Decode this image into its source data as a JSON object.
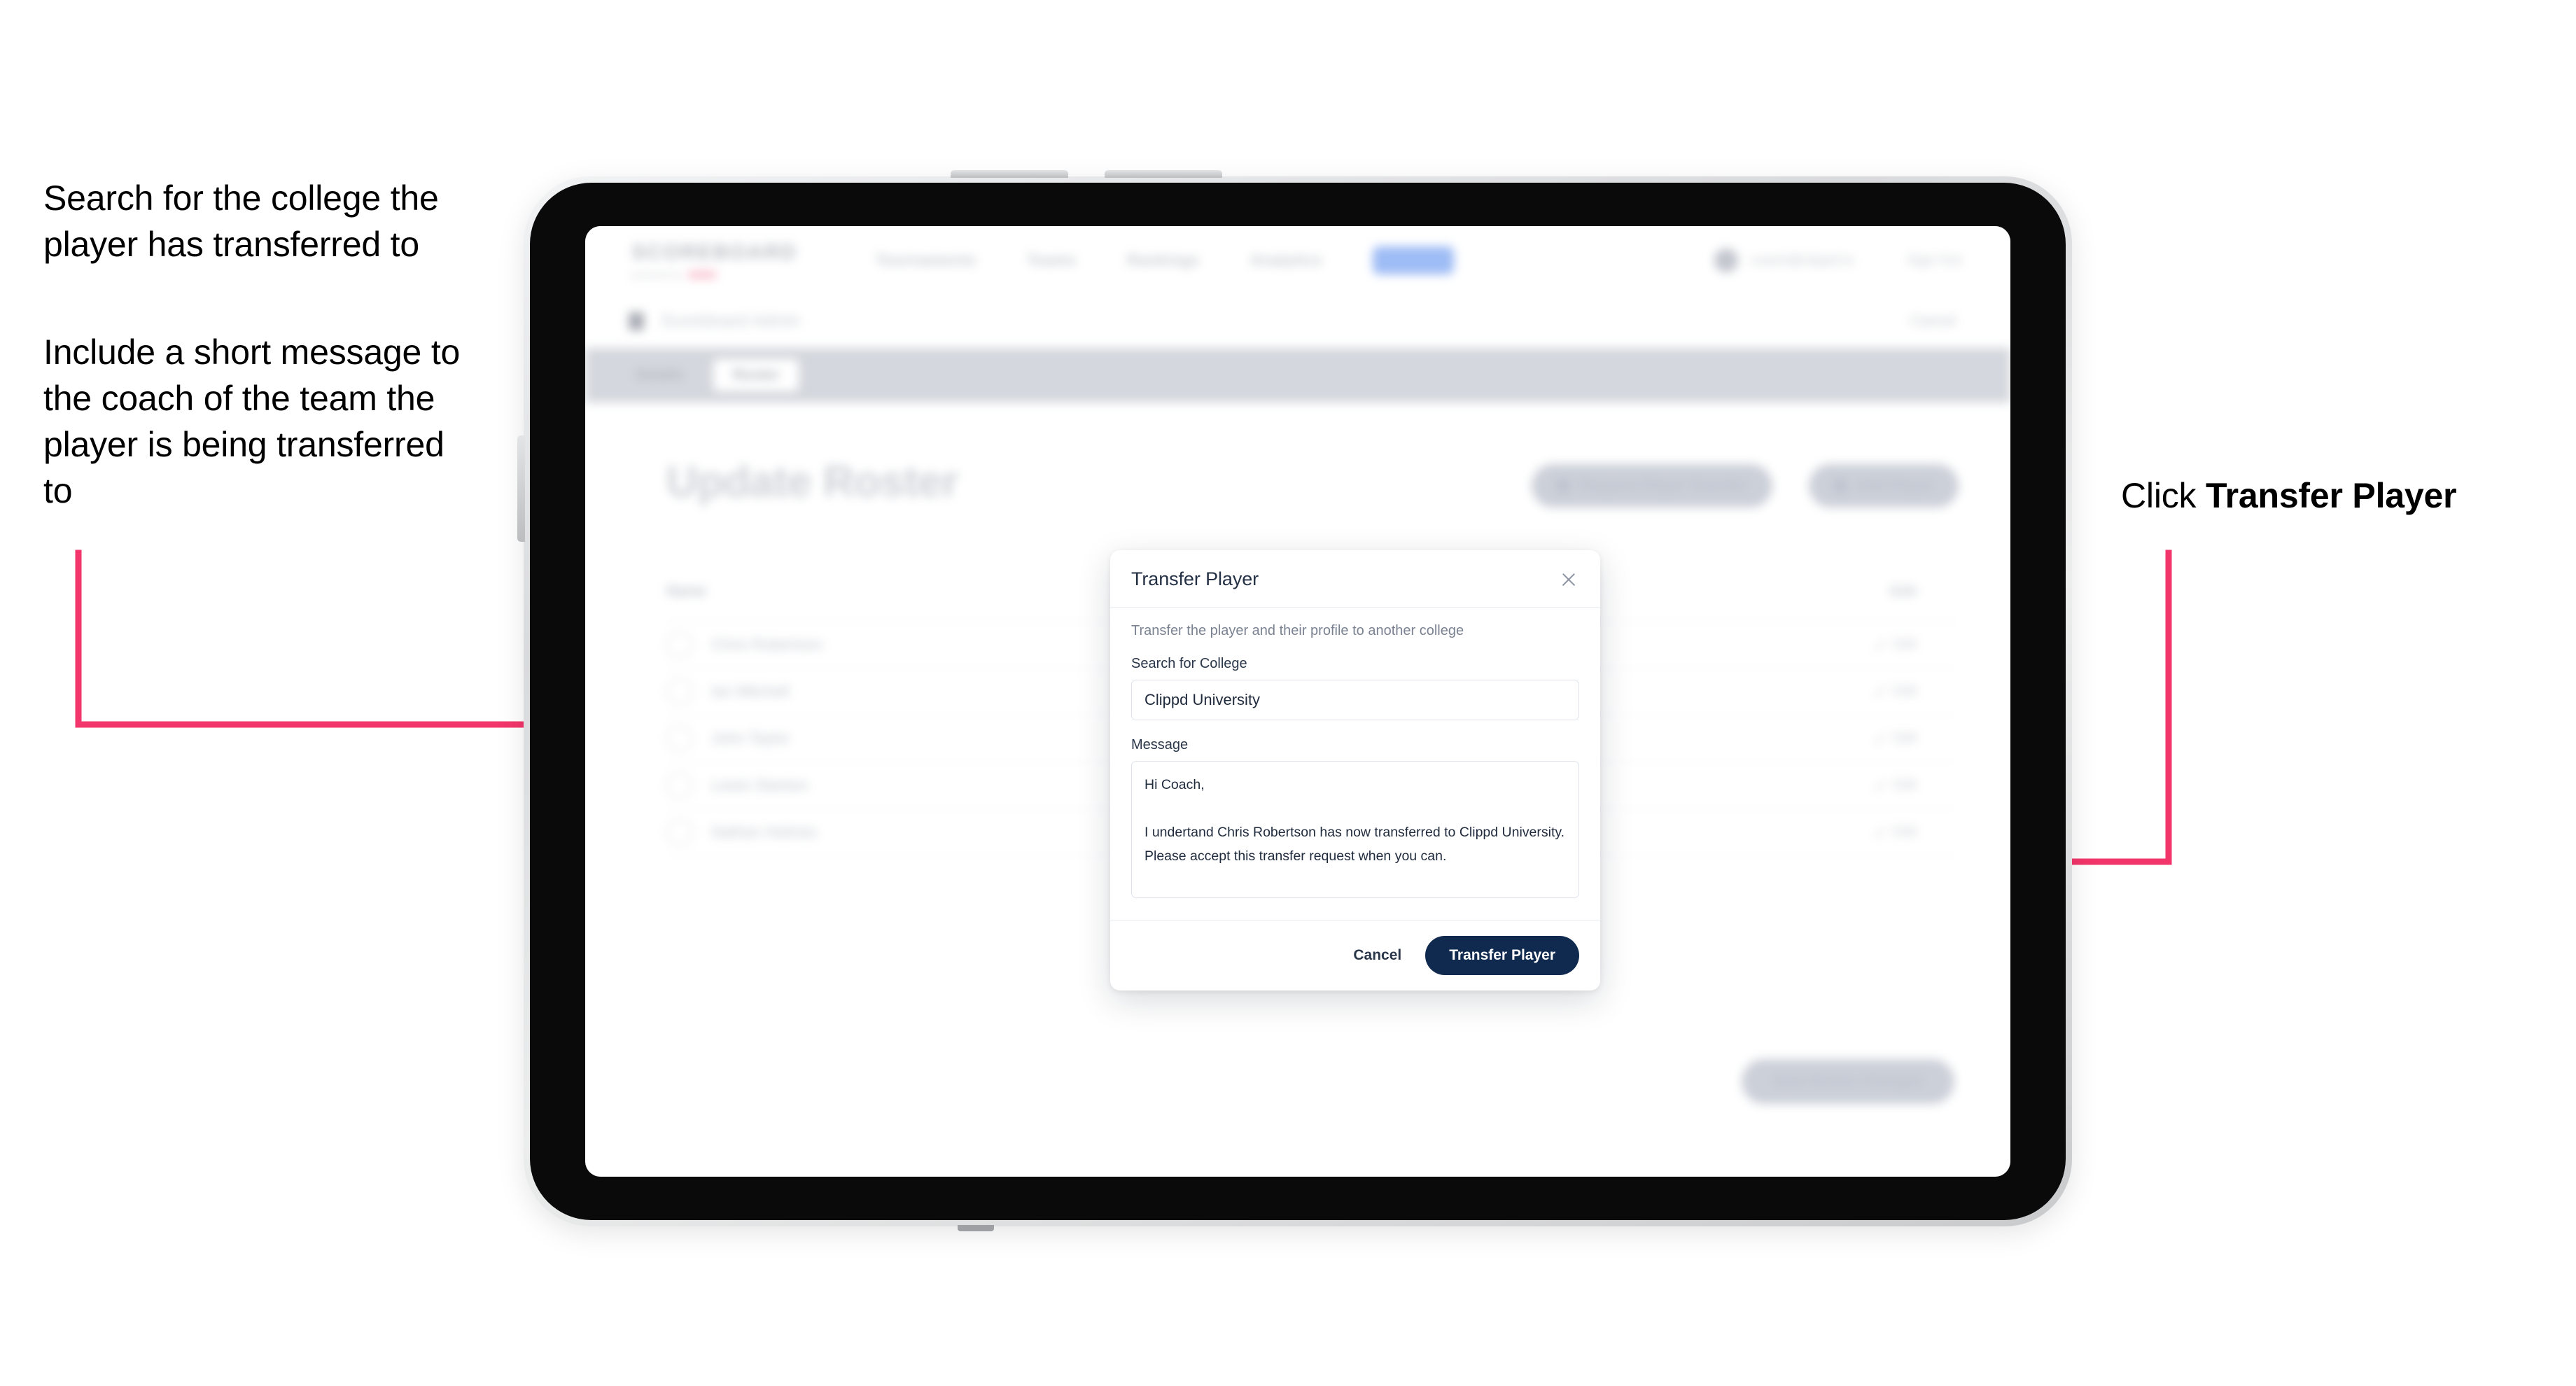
{
  "annotations": {
    "left_1": "Search for the college the player has transferred to",
    "left_2": "Include a short message to the coach of the team the player is being transferred to",
    "right_1_prefix": "Click ",
    "right_1_bold": "Transfer Player"
  },
  "colors": {
    "arrow": "#F2356A",
    "primary_button": "#0F2A4E",
    "device_bezel": "#0A0A0B",
    "device_frame": "#D9DADC",
    "tab_bar": "#D4D7DD"
  },
  "app": {
    "header": {
      "logo_word": "SCOREBOARD",
      "logo_sub": "powered by",
      "logo_badge": "clippd",
      "nav": [
        {
          "label": "Tournaments"
        },
        {
          "label": "Teams"
        },
        {
          "label": "Rankings"
        },
        {
          "label": "Analytics"
        },
        {
          "label": "Admin"
        }
      ],
      "user_email": "coach@clippd.io",
      "sign_out": "Sign Out"
    },
    "breadcrumb": {
      "icon": "building-icon",
      "title": "Scoreboard",
      "subtitle": "Admin",
      "right_action": "Cancel"
    },
    "tabs": [
      {
        "label": "Details",
        "active": false
      },
      {
        "label": "Roster",
        "active": true
      }
    ],
    "page_title": "Update Roster",
    "actions": [
      {
        "label": "Request Player Transfer",
        "icon": "transfer-icon"
      },
      {
        "label": "Add Player",
        "icon": "plus-icon"
      }
    ],
    "roster": {
      "col_name": "Name",
      "col_action": "Edit",
      "rows": [
        {
          "name": "Chris Robertson",
          "action": "Edit"
        },
        {
          "name": "Ian Mitchell",
          "action": "Edit"
        },
        {
          "name": "John Taylor",
          "action": "Edit"
        },
        {
          "name": "Lewis Stanton",
          "action": "Edit"
        },
        {
          "name": "Nathan Holmes",
          "action": "Edit"
        }
      ]
    },
    "save_button": "Save Roster Changes"
  },
  "modal": {
    "title": "Transfer Player",
    "close_icon": "close-icon",
    "subtitle": "Transfer the player and their profile to another college",
    "college_label": "Search for College",
    "college_value": "Clippd University",
    "college_placeholder": "Search for College",
    "message_label": "Message",
    "message_value": "Hi Coach,\n\nI undertand Chris Robertson has now transferred to Clippd University. Please accept this transfer request when you can.",
    "message_placeholder": "Message",
    "cancel_label": "Cancel",
    "submit_label": "Transfer Player"
  }
}
